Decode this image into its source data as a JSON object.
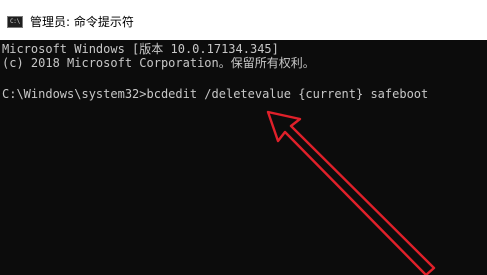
{
  "window": {
    "title": "管理员: 命令提示符",
    "icon": "cmd-icon",
    "icon_glyph": "C:\\"
  },
  "console": {
    "lines": [
      "Microsoft Windows [版本 10.0.17134.345]",
      "(c) 2018 Microsoft Corporation。保留所有权利。",
      "C:\\Windows\\system32>bcdedit /deletevalue {current} safeboot"
    ],
    "text_color": "#c7c7c7",
    "background_color": "#0c0c0c"
  },
  "annotation": {
    "arrow_color": "#e0202a"
  }
}
